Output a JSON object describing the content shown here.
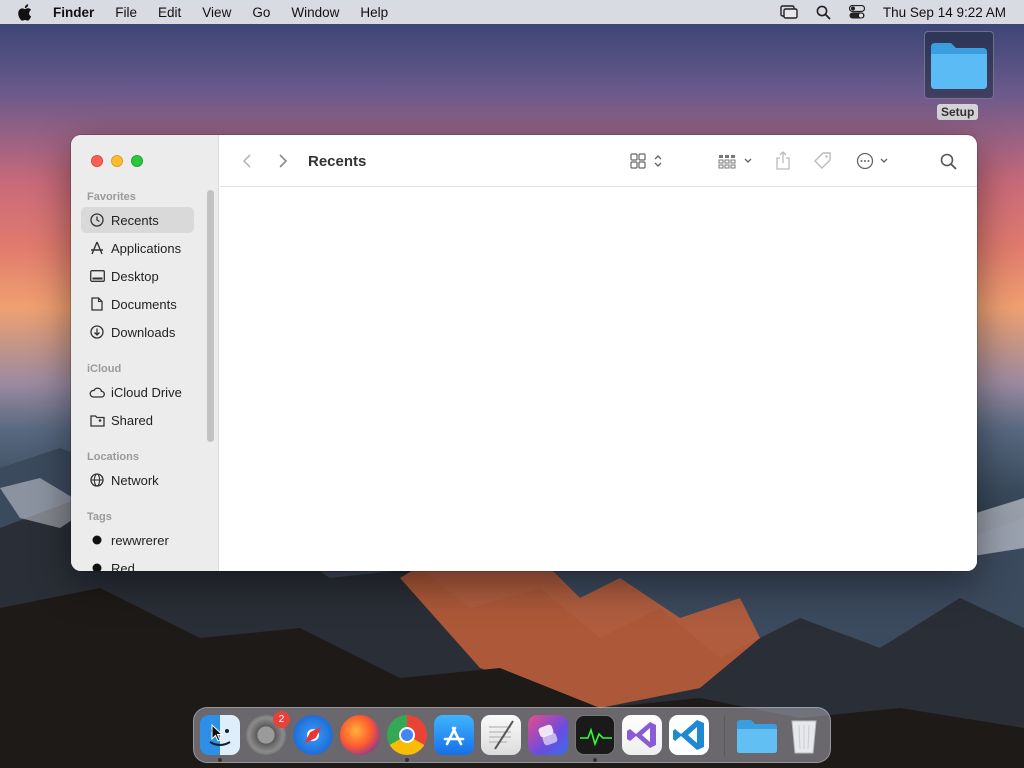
{
  "menubar": {
    "app_name": "Finder",
    "menus": [
      "File",
      "Edit",
      "View",
      "Go",
      "Window",
      "Help"
    ],
    "clock": "Thu Sep 14  9:22 AM"
  },
  "desktop": {
    "folder_label": "Setup"
  },
  "finder": {
    "title": "Recents",
    "sidebar": {
      "favorites_title": "Favorites",
      "favorites": [
        "Recents",
        "Applications",
        "Desktop",
        "Documents",
        "Downloads"
      ],
      "icloud_title": "iCloud",
      "icloud": [
        "iCloud Drive",
        "Shared"
      ],
      "locations_title": "Locations",
      "locations": [
        "Network"
      ],
      "tags_title": "Tags",
      "tags": [
        "rewwrerer",
        "Red"
      ]
    }
  },
  "dock": {
    "settings_badge": "2"
  },
  "colors": {
    "close": "#ff5f57",
    "minimize": "#febc2e",
    "zoom": "#28c840",
    "selection": "#d9d9d9"
  }
}
